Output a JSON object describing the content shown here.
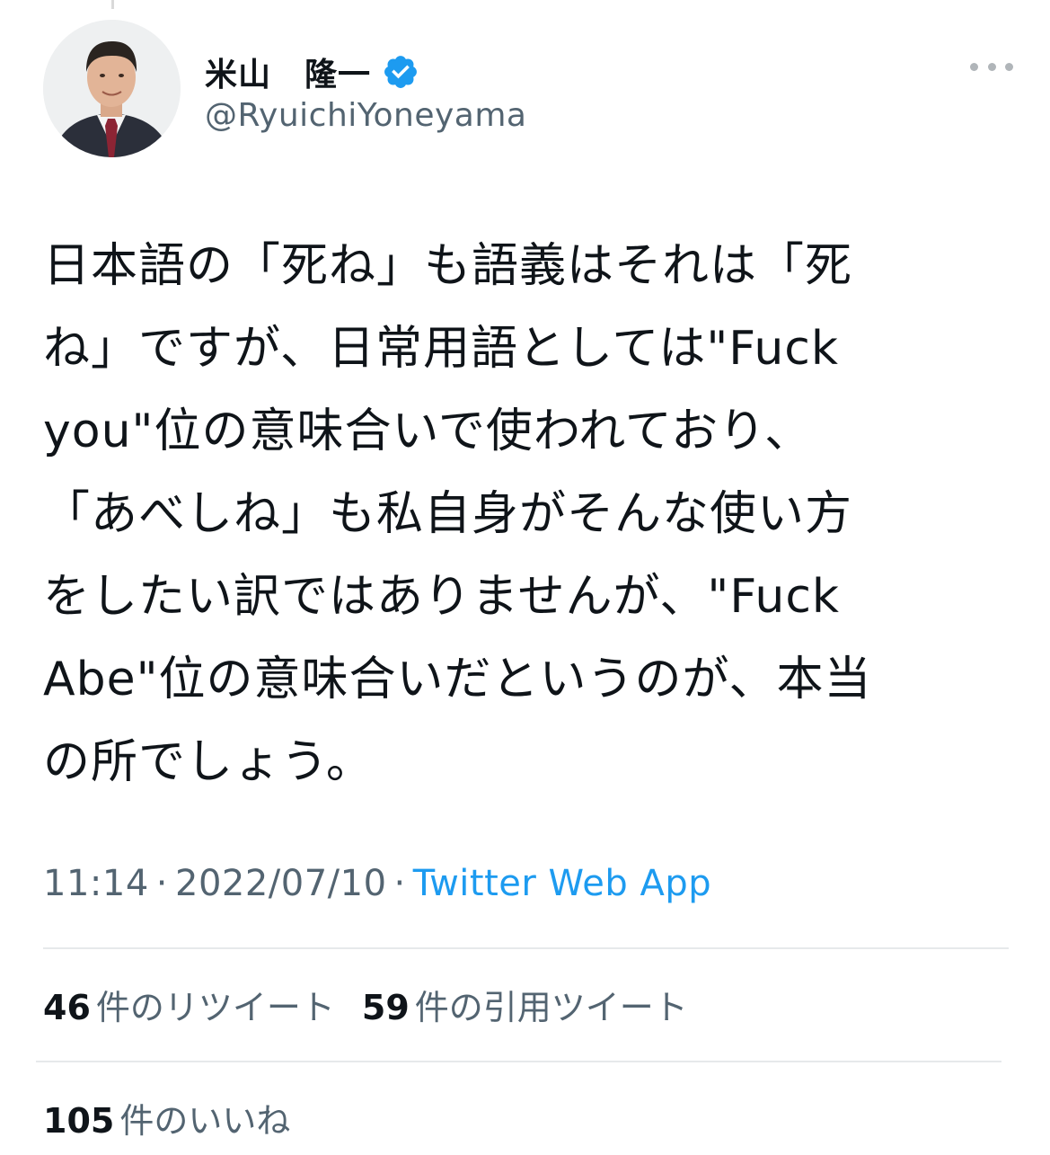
{
  "author": {
    "display_name": "米山　隆一",
    "username": "@RyuichiYoneyama",
    "verified": true
  },
  "tweet": {
    "lines": [
      "日本語の「死ね」も語義はそれは「死",
      "ね」ですが、日常用語としては\"Fuck",
      "you\"位の意味合いで使われており、",
      "「あべしね」も私自身がそんな使い方",
      "をしたい訳ではありませんが、\"Fuck",
      "Abe\"位の意味合いだというのが、本当",
      "の所でしょう。"
    ],
    "time": "11:14",
    "separator": "·",
    "date": "2022/07/10",
    "source": "Twitter Web App"
  },
  "stats": {
    "retweets": {
      "count": "46",
      "label": "件のリツイート"
    },
    "quotes": {
      "count": "59",
      "label": "件の引用ツイート"
    },
    "likes": {
      "count": "105",
      "label": "件のいいね"
    }
  },
  "colors": {
    "text": "#0f1419",
    "secondary": "#536471",
    "link": "#1d9bf0",
    "verified": "#1d9bf0",
    "divider": "#e6e9eb"
  },
  "icons": {
    "verified": "verified-badge-icon",
    "more": "more-options-icon",
    "avatar": "avatar-photo"
  }
}
